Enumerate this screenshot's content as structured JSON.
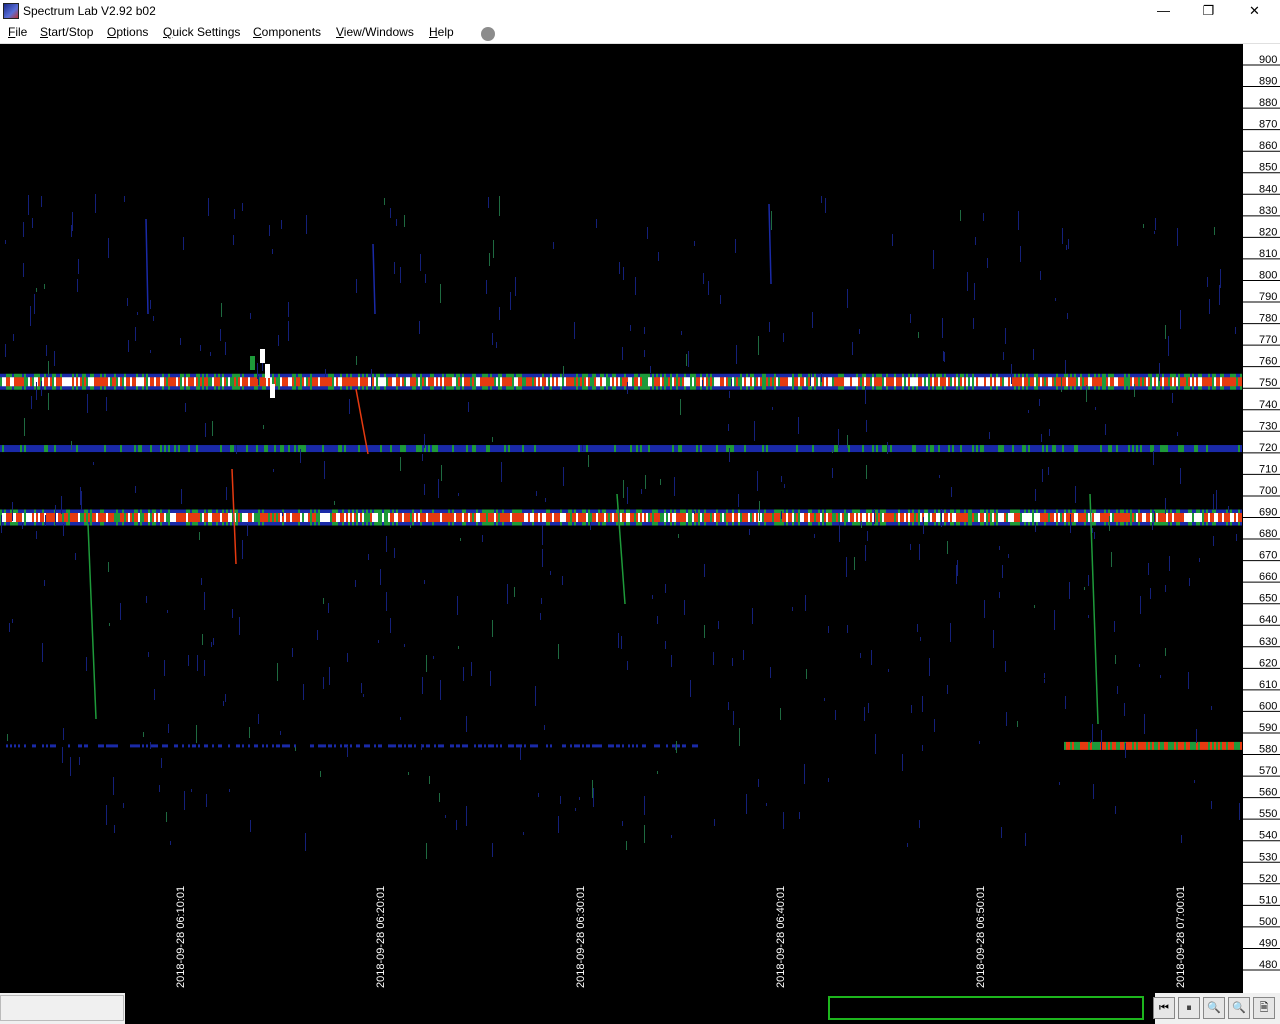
{
  "window": {
    "title": "Spectrum Lab V2.92 b02",
    "minimize_glyph": "—",
    "maximize_glyph": "❐",
    "close_glyph": "✕"
  },
  "menu": {
    "items": [
      {
        "label": "File",
        "accel": "F",
        "rest": "ile"
      },
      {
        "label": "Start/Stop",
        "accel": "S",
        "rest": "tart/Stop"
      },
      {
        "label": "Options",
        "accel": "O",
        "rest": "ptions"
      },
      {
        "label": "Quick Settings",
        "accel": "Q",
        "rest": "uick Settings"
      },
      {
        "label": "Components",
        "accel": "C",
        "rest": "omponents"
      },
      {
        "label": "View/Windows",
        "accel": "V",
        "rest": "iew/Windows"
      },
      {
        "label": "Help",
        "accel": "H",
        "rest": "elp"
      }
    ]
  },
  "waterfall": {
    "freq_ticks": [
      "900",
      "890",
      "880",
      "870",
      "860",
      "850",
      "840",
      "830",
      "820",
      "810",
      "800",
      "790",
      "780",
      "770",
      "760",
      "750",
      "740",
      "730",
      "720",
      "710",
      "700",
      "690",
      "680",
      "670",
      "660",
      "650",
      "640",
      "630",
      "620",
      "610",
      "600",
      "590",
      "580",
      "570",
      "560",
      "550",
      "540",
      "530",
      "520",
      "510",
      "500",
      "490",
      "480"
    ],
    "time_labels": [
      "2018-09-28 06:10:01",
      "2018-09-28 06:20:01",
      "2018-09-28 06:30:01",
      "2018-09-28 06:40:01",
      "2018-09-28 06:50:01",
      "2018-09-28 07:00:01"
    ],
    "colors": {
      "background": "#000000",
      "weak": "#1a2aa8",
      "mid": "#1e9a3a",
      "strong": "#e63a10",
      "peak": "#ffffff"
    }
  },
  "status": {
    "buttons": [
      {
        "name": "rewind-icon",
        "glyph": "⏮"
      },
      {
        "name": "pause-icon",
        "glyph": "⏸"
      },
      {
        "name": "zoom-in-icon",
        "glyph": "🔍"
      },
      {
        "name": "zoom-out-icon",
        "glyph": "🔍"
      },
      {
        "name": "export-icon",
        "glyph": "🗎"
      }
    ]
  }
}
